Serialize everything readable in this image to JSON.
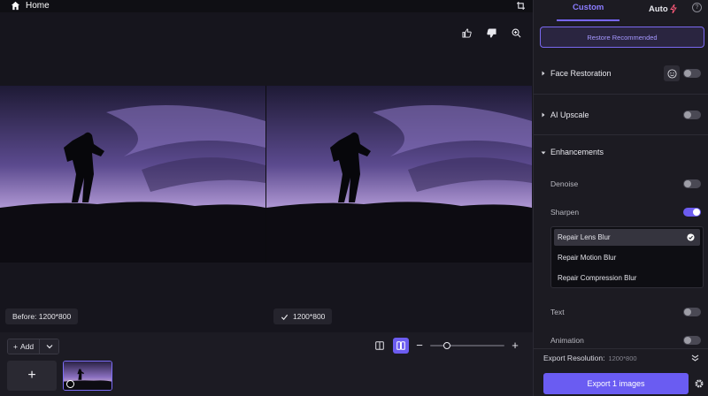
{
  "topbar": {
    "home_label": "Home"
  },
  "preview": {
    "before_label": "Before: 1200*800",
    "after_label": "1200*800"
  },
  "bottombar": {
    "add_label": "Add",
    "thumb_add_symbol": "+",
    "zoom_level": 0.2
  },
  "panel": {
    "tabs": [
      {
        "label": "Custom"
      },
      {
        "label": "Auto"
      }
    ],
    "restore_label": "Restore Recommended",
    "face_restoration": {
      "label": "Face Restoration",
      "enabled": false
    },
    "ai_upscale": {
      "label": "AI Upscale",
      "enabled": false
    },
    "enhancements": {
      "label": "Enhancements",
      "denoise": {
        "label": "Denoise",
        "enabled": false
      },
      "sharpen": {
        "label": "Sharpen",
        "enabled": true
      },
      "sharpen_options": [
        {
          "label": "Repair Lens Blur",
          "selected": true
        },
        {
          "label": "Repair Motion Blur",
          "selected": false
        },
        {
          "label": "Repair Compression Blur",
          "selected": false
        }
      ],
      "text": {
        "label": "Text",
        "enabled": false
      },
      "animation": {
        "label": "Animation",
        "enabled": false
      }
    },
    "export_resolution_label": "Export Resolution:",
    "export_resolution_value": "1200*800",
    "export_button": "Export 1 images"
  },
  "colors": {
    "accent": "#6c5cf0",
    "accent_text": "#8b7cff",
    "panel_bg": "#1c1b22"
  },
  "icons": [
    "home-icon",
    "crop-icon",
    "thumbs-up-icon",
    "thumbs-down-icon",
    "zoom-in-icon",
    "check-icon",
    "chevron-down-icon",
    "single-view-icon",
    "split-view-icon",
    "lightning-icon",
    "help-icon",
    "face-icon",
    "settings-icon"
  ]
}
